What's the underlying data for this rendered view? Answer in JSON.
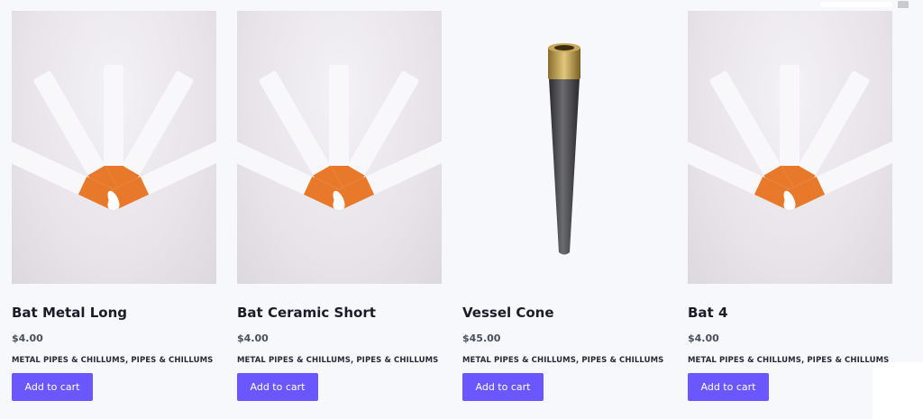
{
  "products": [
    {
      "title": "Bat Metal Long",
      "price": "$4.00",
      "categories": "METAL PIPES & CHILLUMS, PIPES & CHILLUMS",
      "button": "Add to cart",
      "image": "cigarette-bats"
    },
    {
      "title": "Bat Ceramic Short",
      "price": "$4.00",
      "categories": "METAL PIPES & CHILLUMS, PIPES & CHILLUMS",
      "button": "Add to cart",
      "image": "cigarette-bats"
    },
    {
      "title": "Vessel Cone",
      "price": "$45.00",
      "categories": "METAL PIPES & CHILLUMS, PIPES & CHILLUMS",
      "button": "Add to cart",
      "image": "vessel-cone"
    },
    {
      "title": "Bat 4",
      "price": "$4.00",
      "categories": "METAL PIPES & CHILLUMS, PIPES & CHILLUMS",
      "button": "Add to cart",
      "image": "cigarette-bats"
    }
  ],
  "colors": {
    "button": "#6a57ff",
    "background": "#f7f8fc",
    "filter": "#e8792b"
  }
}
